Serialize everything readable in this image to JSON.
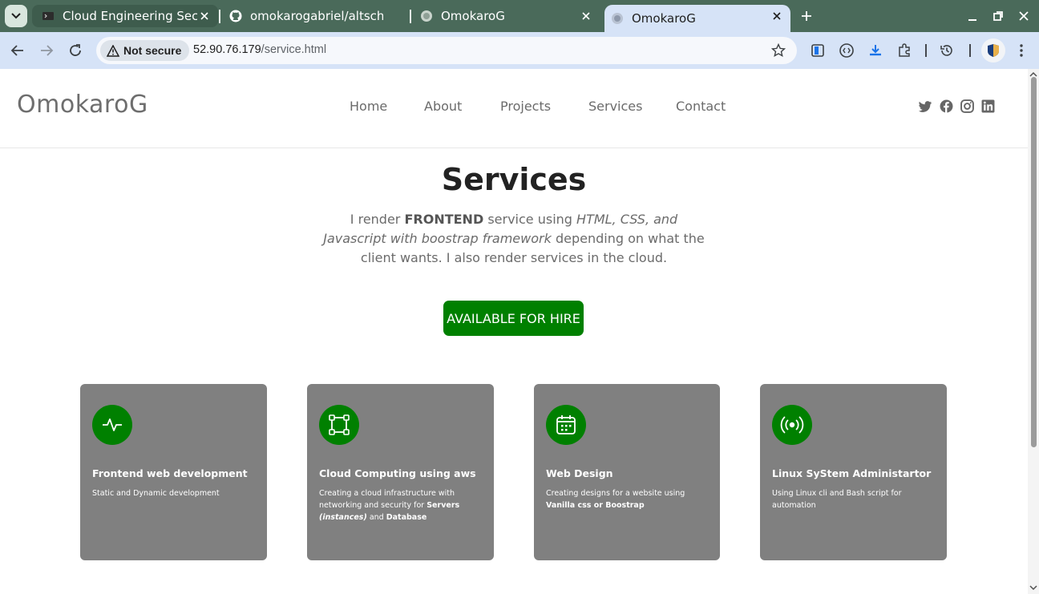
{
  "browser": {
    "tabs": [
      {
        "title": "Cloud Engineering Secon",
        "icon": "terminal-icon",
        "active": false
      },
      {
        "title": "omokarogabriel/altschoo",
        "icon": "github-icon",
        "active": false
      },
      {
        "title": "OmokaroG",
        "icon": "globe-icon",
        "active": false
      },
      {
        "title": "OmokaroG",
        "icon": "globe-icon",
        "active": true
      }
    ],
    "security_label": "Not secure",
    "url_host": "52.90.76.179",
    "url_path": "/service.html"
  },
  "site": {
    "brand": "OmokaroG",
    "nav": [
      "Home",
      "About",
      "Projects",
      "Services",
      "Contact"
    ],
    "social": [
      "twitter-icon",
      "facebook-icon",
      "instagram-icon",
      "linkedin-icon"
    ]
  },
  "hero": {
    "title": "Services",
    "text_part1": "I render ",
    "text_bold": "FRONTEND",
    "text_part2": " service using ",
    "text_italic": "HTML, CSS, and Javascript with boostrap framework",
    "text_part3": " depending on what the client wants. I also render services in the cloud.",
    "button": "AVAILABLE FOR HIRE"
  },
  "cards": [
    {
      "icon": "activity-icon",
      "title": "Frontend web development",
      "text": "Static and Dynamic development"
    },
    {
      "icon": "bounding-box-icon",
      "title": "Cloud Computing using aws",
      "text_part1": "Creating a cloud infrastructure with networking and security for ",
      "text_bold1": "Servers",
      "text_italic_bold": "(instances)",
      "text_part2": " and ",
      "text_bold2": "Database"
    },
    {
      "icon": "calendar-icon",
      "title": "Web Design",
      "text_part1": "Creating designs for a website using ",
      "text_bold": "Vanilla css or Boostrap"
    },
    {
      "icon": "broadcast-icon",
      "title": "Linux SyStem Administartor",
      "text": "Using Linux cli and Bash script for automation"
    }
  ],
  "colors": {
    "accent_green": "#008000",
    "card_gray": "#808080",
    "tabbar": "#4a6a5a",
    "toolbar": "#d6e3f7"
  }
}
